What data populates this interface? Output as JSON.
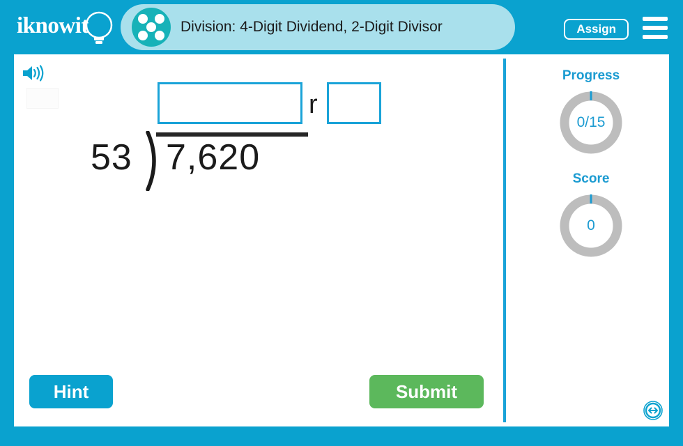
{
  "header": {
    "logo_text": "iknowit",
    "logo_icon": "lightbulb-icon",
    "title": "Division: 4-Digit Dividend, 2-Digit Divisor",
    "title_icon": "five-dots-circle-icon",
    "assign_label": "Assign",
    "menu_icon": "hamburger-menu-icon"
  },
  "toolbar": {
    "speaker_icon": "speaker-audio-icon"
  },
  "problem": {
    "divisor": "53",
    "dividend": "7,620",
    "remainder_label": "r",
    "quotient_value": "",
    "quotient_placeholder": "",
    "remainder_value": "",
    "remainder_placeholder": ""
  },
  "rail": {
    "progress_label": "Progress",
    "progress_value": "0/15",
    "score_label": "Score",
    "score_value": "0"
  },
  "actions": {
    "hint_label": "Hint",
    "submit_label": "Submit",
    "resize_icon": "horizontal-resize-arrows-icon"
  },
  "colors": {
    "frame_blue": "#0aa2cf",
    "title_band": "#a9e0ec",
    "title_icon_teal": "#17b2b8",
    "input_border": "#1aa3d8",
    "submit_green": "#5cb85c",
    "ring_gray": "#bdbdbd",
    "ring_tick": "#1b9bd1",
    "accent_text": "#1b9bd1"
  }
}
